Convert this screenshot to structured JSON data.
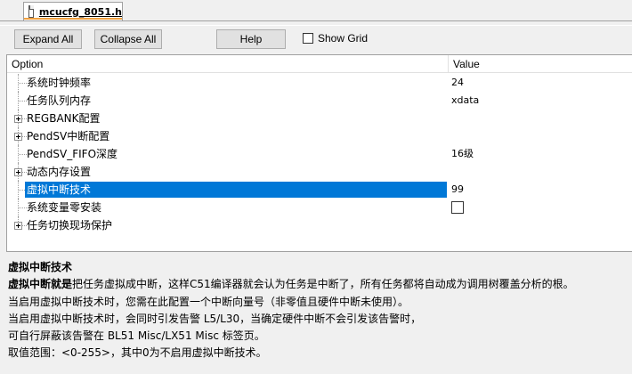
{
  "tab": {
    "filename": "mcucfg_8051.h",
    "icon": "file-icon"
  },
  "toolbar": {
    "expand_label": "Expand All",
    "collapse_label": "Collapse All",
    "help_label": "Help",
    "show_grid_label": "Show Grid",
    "show_grid_checked": false
  },
  "grid": {
    "columns": {
      "option": "Option",
      "value": "Value"
    },
    "rows": [
      {
        "label": "系统时钟频率",
        "value": "24",
        "expandable": false
      },
      {
        "label": "任务队列内存",
        "value": "xdata",
        "expandable": false
      },
      {
        "label": "REGBANK配置",
        "value": "",
        "expandable": true
      },
      {
        "label": "PendSV中断配置",
        "value": "",
        "expandable": true
      },
      {
        "label": "PendSV_FIFO深度",
        "value": "16级",
        "expandable": false
      },
      {
        "label": "动态内存设置",
        "value": "",
        "expandable": true
      },
      {
        "label": "虚拟中断技术",
        "value": "99",
        "expandable": false,
        "selected": true
      },
      {
        "label": "系统变量零安装",
        "value": "",
        "expandable": false,
        "checkbox": true,
        "checked": false
      },
      {
        "label": "任务切换现场保护",
        "value": "",
        "expandable": true
      }
    ]
  },
  "description": {
    "title": "虚拟中断技术",
    "line1_bold": "虚拟中断就是",
    "line1_rest": "把任务虚拟成中断，这样C51编译器就会认为任务是中断了，所有任务都将自动成为调用树覆盖分析的根。",
    "line2": "当启用虚拟中断技术时，您需在此配置一个中断向量号（非零值且硬件中断未使用）。",
    "line3": "当启用虚拟中断技术时，会同时引发告警 L5/L30，当确定硬件中断不会引发该告警时，",
    "line4": "可自行屏蔽该告警在 BL51 Misc/LX51 Misc 标签页。",
    "line5": "取值范围：<0-255>，其中0为不启用虚拟中断技术。"
  },
  "colors": {
    "selection": "#0078d7",
    "tab_accent": "#f0a040"
  }
}
